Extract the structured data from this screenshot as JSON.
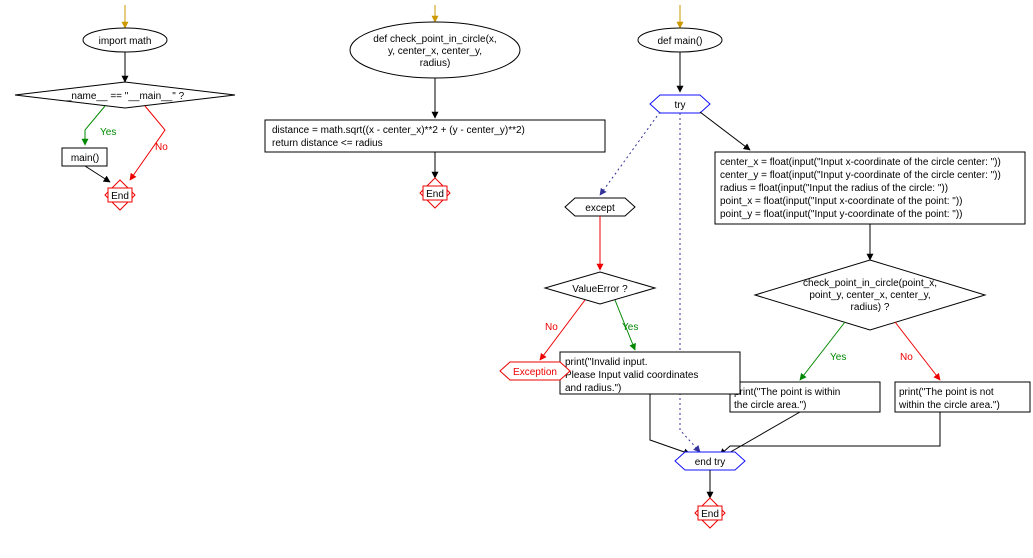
{
  "col1": {
    "import": "import math",
    "cond": "_name__ == \"__main__\" ?",
    "yes": "Yes",
    "no": "No",
    "main": "main()",
    "end": "End"
  },
  "col2": {
    "def1": "def check_point_in_circle(x,",
    "def2": "y, center_x, center_y,",
    "def3": "radius)",
    "body1": "distance = math.sqrt((x - center_x)**2 + (y - center_y)**2)",
    "body2": "return distance <= radius",
    "end": "End"
  },
  "col3": {
    "def": "def main()",
    "try": "try",
    "except": "except",
    "valerr": "ValueError ?",
    "yes": "Yes",
    "no": "No",
    "exception": "Exception",
    "err1": "print(\"Invalid input.",
    "err2": "Please Input valid coordinates",
    "err3": "and radius.\")",
    "inp1": "center_x = float(input(\"Input x-coordinate of the circle center: \"))",
    "inp2": "center_y = float(input(\"Input y-coordinate of the circle center: \"))",
    "inp3": "radius = float(input(\"Input the radius of the circle: \"))",
    "inp4": "point_x = float(input(\"Input x-coordinate of the point: \"))",
    "inp5": "point_y = float(input(\"Input y-coordinate of the point: \"))",
    "cond1": "check_point_in_circle(point_x,",
    "cond2": "point_y, center_x, center_y,",
    "cond3": "radius) ?",
    "in1": "print(\"The point is within",
    "in2": "the circle area.\")",
    "out1": "print(\"The point is not",
    "out2": "within the circle area.\")",
    "endtry": "end try",
    "end": "End"
  }
}
